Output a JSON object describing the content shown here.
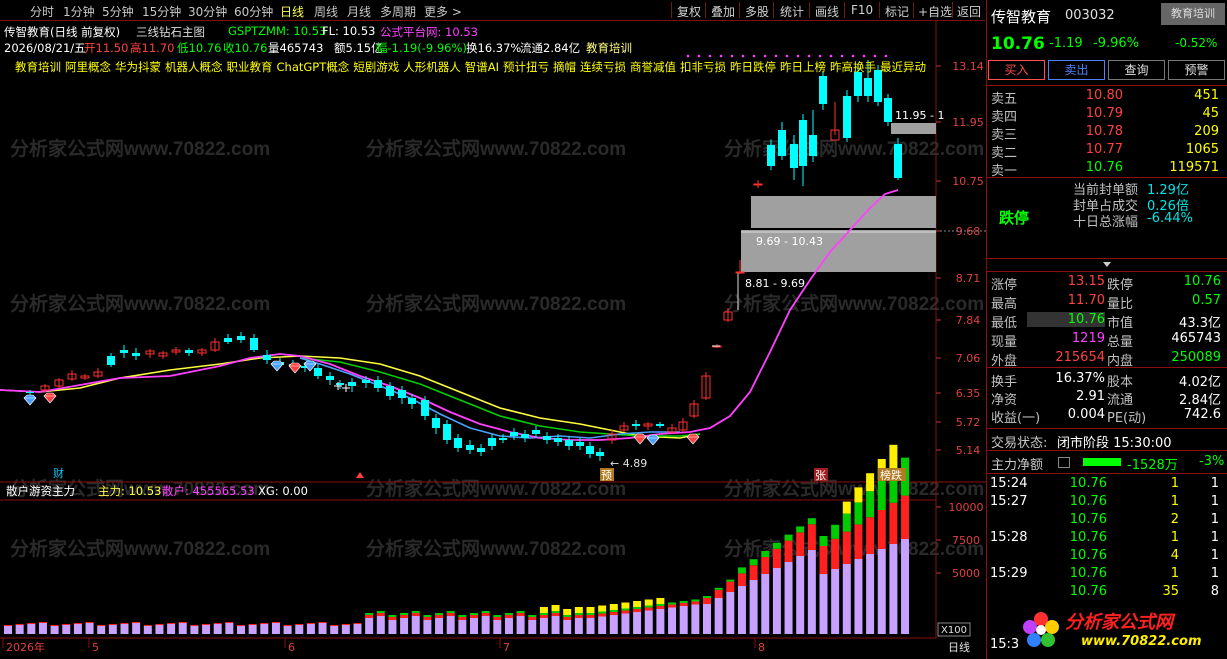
{
  "toolbar": {
    "periods": [
      "分时",
      "1分钟",
      "5分钟",
      "15分钟",
      "30分钟",
      "60分钟",
      "日线",
      "周线",
      "月线",
      "多周期",
      "更多 >"
    ],
    "active_period": "日线",
    "right_buttons": [
      "复权",
      "叠加",
      "多股",
      "统计",
      "画线",
      "F10",
      "标记",
      "+自选",
      "返回"
    ]
  },
  "chart_header": {
    "stock_title": "传智教育(日线 前复权)",
    "indicator_name": "三线钻石主图",
    "gsptzmm": "GSPTZMM: 10.53",
    "fl": "FL: 10.53",
    "platform": "公式平台网: 10.53",
    "date": "2026/08/21/五",
    "open": "开11.50",
    "high": "高11.70",
    "low": "低10.76",
    "close": "收10.76",
    "volume": "量465743",
    "amount": "额5.15亿",
    "change": "幅-1.19(-9.96%)",
    "turnover": "换16.37%",
    "float_cap": "流通2.84亿",
    "sector": "教育培训"
  },
  "concepts": [
    "教育培训",
    "阿里概念",
    "华为抖蒙",
    "机器人概念",
    "职业教育",
    "ChatGPT概念",
    "短剧游戏",
    "人形机器人",
    "智谱AI",
    "预计扭亏",
    "摘帽",
    "连续亏损",
    "商誉减值",
    "扣非亏损",
    "昨日跌停",
    "昨日上榜",
    "昨高换手",
    "最近异动"
  ],
  "price_axis": [
    "13.14",
    "11.95",
    "10.75",
    "9.68",
    "8.71",
    "7.84",
    "7.06",
    "6.35",
    "5.72",
    "5.14"
  ],
  "price_labels": {
    "zone_top": "11.95 - 1",
    "zone_mid": "9.69 - 10.43",
    "zone_low": "8.81 - 9.69",
    "low_mark": "4.89"
  },
  "markers": {
    "cai": "财",
    "yu": "预",
    "zhang": "张",
    "bangdie": "榜跌"
  },
  "sub_header": {
    "name": "散户游资主力",
    "zhuli": "主力: 10.53",
    "sanhu": "散户: 455565.53",
    "xg": "XG: 0.00"
  },
  "sub_axis": [
    "10000",
    "7500",
    "5000"
  ],
  "sub_multiplier": "X100",
  "time_axis": {
    "labels": [
      "2026年",
      "5",
      "6",
      "7",
      "8"
    ],
    "period": "日线"
  },
  "watermark": "分析家公式网www.70822.com",
  "right_panel": {
    "name": "传智教育",
    "code": "003032",
    "sector_tag": "教育培训",
    "sector_change": "-0.52%",
    "price": "10.76",
    "change": "-1.19",
    "change_pct": "-9.96%",
    "buttons": [
      "买入",
      "卖出",
      "查询",
      "预警"
    ],
    "asks": [
      {
        "label": "卖五",
        "price": "10.80",
        "vol": "451"
      },
      {
        "label": "卖四",
        "price": "10.79",
        "vol": "45"
      },
      {
        "label": "卖三",
        "price": "10.78",
        "vol": "209"
      },
      {
        "label": "卖二",
        "price": "10.77",
        "vol": "1065"
      },
      {
        "label": "卖一",
        "price": "10.76",
        "vol": "119571"
      }
    ],
    "limit_status": "跌停",
    "seal_info": [
      {
        "label": "当前封单额",
        "value": "1.29亿"
      },
      {
        "label": "封单占成交",
        "value": "0.26倍"
      },
      {
        "label": "十日总涨幅",
        "value": "-6.44%"
      }
    ],
    "stats": [
      {
        "l1": "涨停",
        "v1": "13.15",
        "l2": "跌停",
        "v2": "10.76"
      },
      {
        "l1": "最高",
        "v1": "11.70",
        "l2": "量比",
        "v2": "0.57"
      },
      {
        "l1": "最低",
        "v1": "10.76",
        "l2": "市值",
        "v2": "43.3亿"
      },
      {
        "l1": "现量",
        "v1": "1219",
        "l2": "总量",
        "v2": "465743"
      },
      {
        "l1": "外盘",
        "v1": "215654",
        "l2": "内盘",
        "v2": "250089"
      }
    ],
    "stats2": [
      {
        "l1": "换手",
        "v1": "16.37%",
        "l2": "股本",
        "v2": "4.02亿"
      },
      {
        "l1": "净资",
        "v1": "2.91",
        "l2": "流通",
        "v2": "2.84亿"
      },
      {
        "l1": "收益(一)",
        "v1": "0.004",
        "l2": "PE(动)",
        "v2": "742.6"
      }
    ],
    "trade_status_label": "交易状态:",
    "trade_status": "闭市阶段 15:30:00",
    "mainflow_label": "主力净额",
    "mainflow_value": "-1528万",
    "mainflow_pct": "-3%",
    "ticks": [
      {
        "time": "15:24",
        "price": "10.76",
        "vol": "1",
        "flag": "1"
      },
      {
        "time": "15:27",
        "price": "10.76",
        "vol": "1",
        "flag": "1"
      },
      {
        "time": "",
        "price": "10.76",
        "vol": "2",
        "flag": "1"
      },
      {
        "time": "15:28",
        "price": "10.76",
        "vol": "1",
        "flag": "1"
      },
      {
        "time": "",
        "price": "10.76",
        "vol": "4",
        "flag": "1"
      },
      {
        "time": "15:29",
        "price": "10.76",
        "vol": "1",
        "flag": "1"
      },
      {
        "time": "",
        "price": "10.76",
        "vol": "35",
        "flag": "8"
      }
    ],
    "last_time": "15:3",
    "logo_text": "分析家公式网",
    "logo_url": "www.70822.com"
  }
}
